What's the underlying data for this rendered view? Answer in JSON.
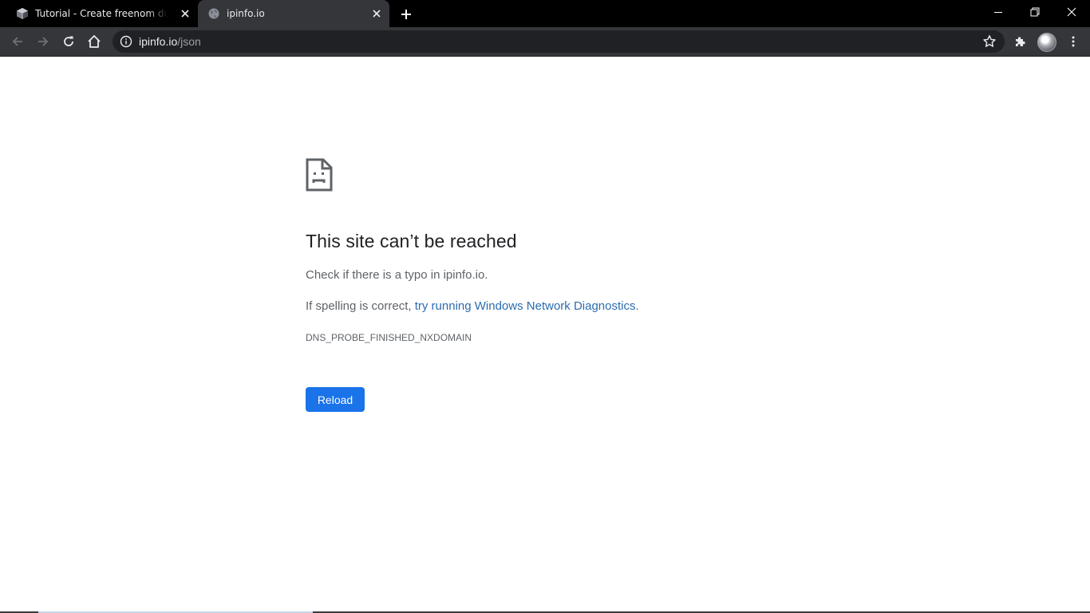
{
  "browser": {
    "tabs": [
      {
        "title": "Tutorial - Create freenom domain",
        "favicon": "vagrant-box-icon",
        "active": false
      },
      {
        "title": "ipinfo.io",
        "favicon": "globe-icon",
        "active": true
      }
    ],
    "new_tab_icon": "plus-icon",
    "window_controls": [
      "minimize-icon",
      "restore-icon",
      "close-icon"
    ],
    "toolbar": {
      "buttons": [
        "back-arrow-icon",
        "forward-arrow-icon",
        "reload-icon",
        "home-icon"
      ],
      "url_host": "ipinfo.io",
      "url_path": "/json",
      "right_icons": [
        "bookmark-star-icon",
        "extensions-puzzle-icon",
        "profile-avatar",
        "menu-kebab-icon"
      ]
    }
  },
  "error_page": {
    "icon": "sad-document-icon",
    "heading": "This site can’t be reached",
    "line1": "Check if there is a typo in ipinfo.io.",
    "line2_prefix": "If spelling is correct, ",
    "line2_link": "try running Windows Network Diagnostics",
    "line2_suffix": ".",
    "error_code": "DNS_PROBE_FINISHED_NXDOMAIN",
    "reload_label": "Reload"
  },
  "colors": {
    "tabstrip_bg": "#000000",
    "toolbar_bg": "#35363a",
    "omnibox_bg": "#202124",
    "heading": "#202124",
    "body_text": "#5f6368",
    "link": "#2b6cb0",
    "button_blue": "#1a73e8"
  }
}
